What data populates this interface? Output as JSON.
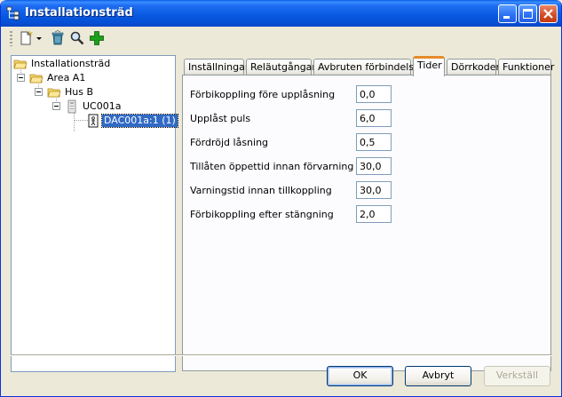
{
  "window": {
    "title": "Installationsträd"
  },
  "toolbar": {
    "icons": [
      "new-document-icon",
      "dropdown-arrow-icon",
      "delete-icon",
      "search-icon",
      "add-icon"
    ]
  },
  "tree": {
    "nodes": [
      {
        "label": "Installationsträd",
        "icon": "folder-open-icon"
      },
      {
        "label": "Area A1",
        "icon": "folder-open-icon"
      },
      {
        "label": "Hus B",
        "icon": "folder-open-icon"
      },
      {
        "label": "UC001a",
        "icon": "controller-icon"
      },
      {
        "label": "DAC001a:1 (1)",
        "icon": "door-icon",
        "selected": true
      }
    ]
  },
  "tabs": [
    {
      "label": "Inställningar"
    },
    {
      "label": "Reläutgångar"
    },
    {
      "label": "Avbruten förbindelse"
    },
    {
      "label": "Tider",
      "active": true
    },
    {
      "label": "Dörrkoder"
    },
    {
      "label": "Funktioner"
    }
  ],
  "fields": [
    {
      "label": "Förbikoppling före upplåsning",
      "value": "0,0"
    },
    {
      "label": "Upplåst puls",
      "value": "6,0"
    },
    {
      "label": "Fördröjd låsning",
      "value": "0,5"
    },
    {
      "label": "Tillåten öppettid innan förvarning",
      "value": "30,0"
    },
    {
      "label": "Varningstid innan tillkoppling",
      "value": "30,0"
    },
    {
      "label": "Förbikoppling efter stängning",
      "value": "2,0"
    }
  ],
  "buttons": {
    "ok": "OK",
    "cancel": "Avbryt",
    "apply": "Verkställ"
  },
  "colors": {
    "titlebar": "#0858e0",
    "selection": "#316ac5",
    "active_tab_accent": "#e68b2c"
  }
}
